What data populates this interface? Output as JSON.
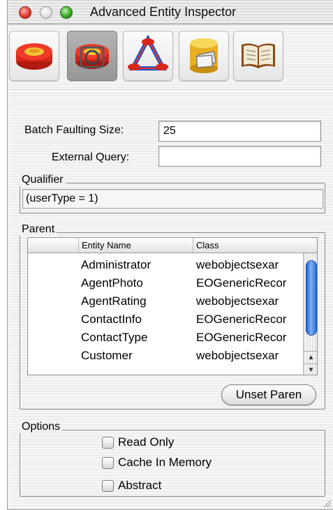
{
  "window": {
    "title": "Advanced Entity Inspector"
  },
  "toolbar": {
    "buttons": [
      {
        "icon": "entity-icon",
        "selected": false
      },
      {
        "icon": "advanced-entity-icon",
        "selected": true
      },
      {
        "icon": "relationship-icon",
        "selected": false
      },
      {
        "icon": "stored-procedure-icon",
        "selected": false
      },
      {
        "icon": "user-info-icon",
        "selected": false
      }
    ]
  },
  "fields": {
    "batch_label": "Batch Faulting Size:",
    "batch_value": "25",
    "external_label": "External Query:",
    "external_value": ""
  },
  "qualifier": {
    "title": "Qualifier",
    "value": "(userType = 1)"
  },
  "parent": {
    "title": "Parent",
    "columns": [
      "",
      "Entity Name",
      "Class"
    ],
    "rows": [
      {
        "name": "Administrator",
        "class": "webobjectsexar"
      },
      {
        "name": "AgentPhoto",
        "class": "EOGenericRecor"
      },
      {
        "name": "AgentRating",
        "class": "webobjectsexar"
      },
      {
        "name": "ContactInfo",
        "class": "EOGenericRecor"
      },
      {
        "name": "ContactType",
        "class": "EOGenericRecor"
      },
      {
        "name": "Customer",
        "class": "webobjectsexar"
      }
    ],
    "unset_button": "Unset Paren"
  },
  "options": {
    "title": "Options",
    "checkboxes": [
      {
        "label": "Read Only",
        "checked": false
      },
      {
        "label": "Cache In Memory",
        "checked": false
      },
      {
        "label": "Abstract",
        "checked": false
      }
    ]
  }
}
